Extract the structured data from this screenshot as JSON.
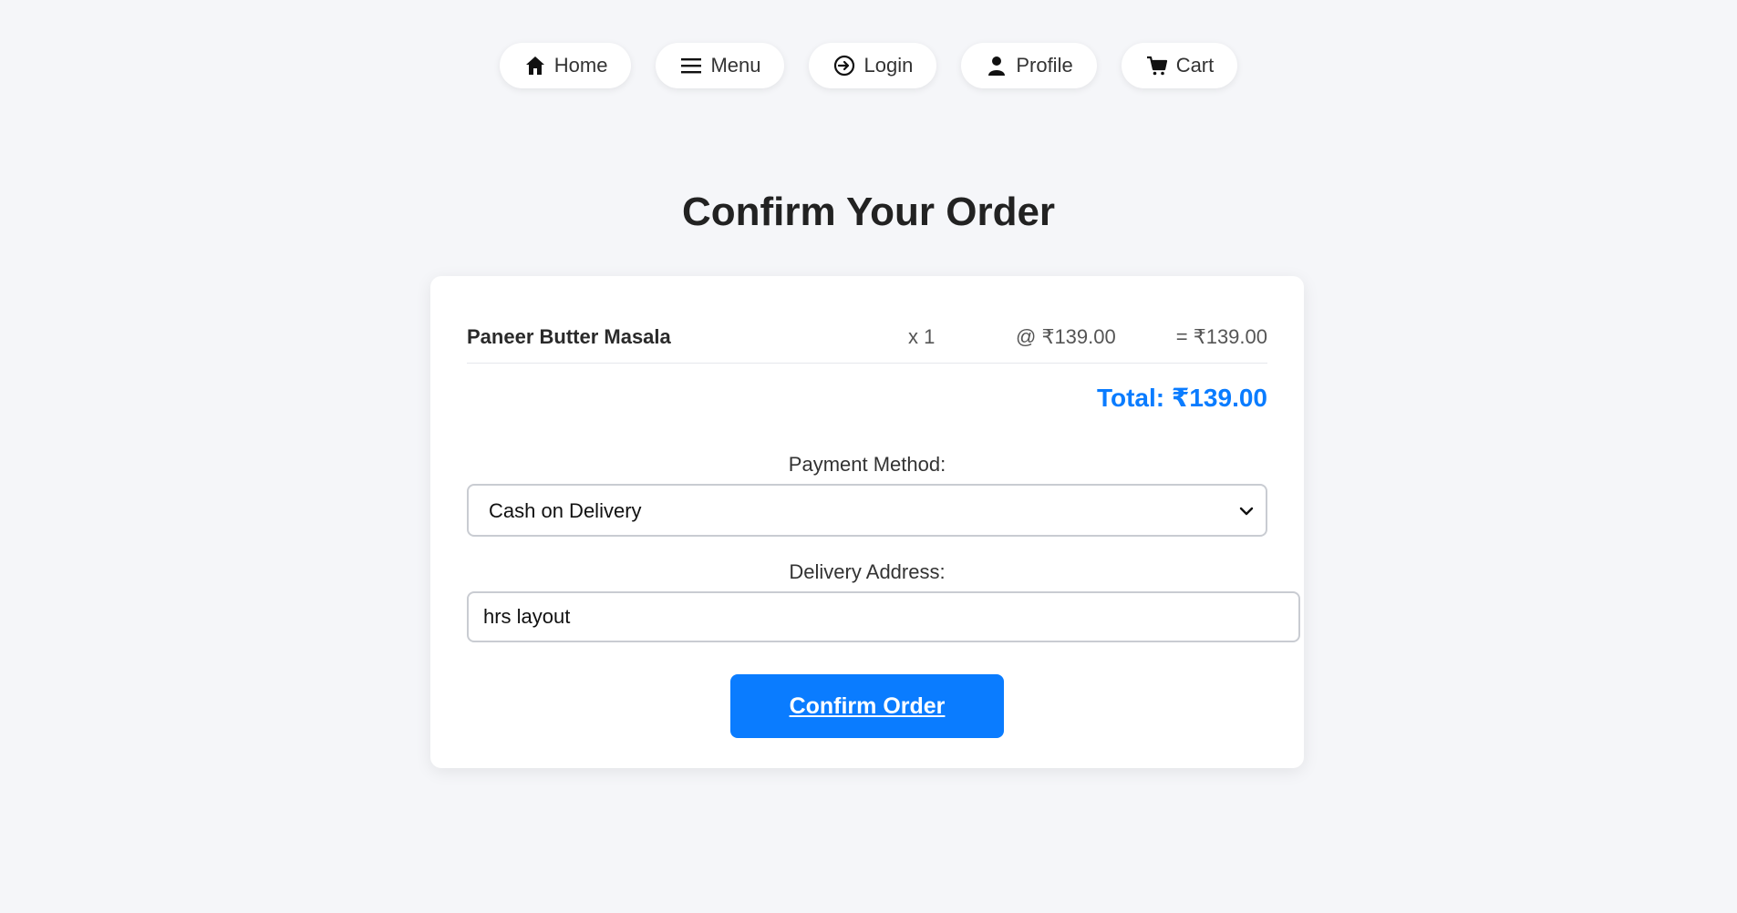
{
  "nav": {
    "items": [
      {
        "label": "Home",
        "icon": "home-icon"
      },
      {
        "label": "Menu",
        "icon": "menu-icon"
      },
      {
        "label": "Login",
        "icon": "login-icon"
      },
      {
        "label": "Profile",
        "icon": "user-icon"
      },
      {
        "label": "Cart",
        "icon": "cart-icon"
      }
    ]
  },
  "page_title": "Confirm Your Order",
  "order": {
    "items": [
      {
        "name": "Paneer Butter Masala",
        "qty": "x 1",
        "price": "@ ₹139.00",
        "subtotal": "= ₹139.00"
      }
    ],
    "total": "Total: ₹139.00"
  },
  "form": {
    "payment_label": "Payment Method:",
    "payment_selected": "Cash on Delivery",
    "address_label": "Delivery Address:",
    "address_value": "hrs layout"
  },
  "confirm_label": "Confirm Order",
  "colors": {
    "accent": "#0a7cff",
    "background": "#f5f6f9"
  }
}
